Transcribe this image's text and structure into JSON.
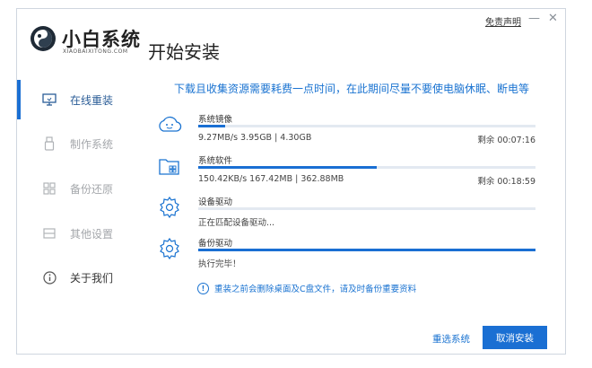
{
  "app": {
    "brand_name": "小白系统",
    "brand_subtitle": "XIAOBAIXITONG.COM",
    "page_title": "开始安装",
    "disclaimer": "免责声明",
    "minimize_glyph": "—",
    "close_glyph": "✕"
  },
  "sidebar": {
    "items": [
      {
        "label": "在线重装",
        "icon": "monitor-icon",
        "active": true
      },
      {
        "label": "制作系统",
        "icon": "usb-drive-icon",
        "active": false
      },
      {
        "label": "备份还原",
        "icon": "grid-icon",
        "active": false
      },
      {
        "label": "其他设置",
        "icon": "settings-box-icon",
        "active": false
      },
      {
        "label": "关于我们",
        "icon": "info-icon",
        "active": false
      }
    ]
  },
  "main": {
    "notice": "下载且收集资源需要耗费一点时间，在此期间尽量不要使电脑休眠、断电等",
    "tasks": [
      {
        "name": "系统镜像",
        "detail": "9.27MB/s 3.95GB | 4.30GB",
        "remaining": "剩余 00:07:16",
        "progress": 0.08,
        "icon": "cloud-download-icon"
      },
      {
        "name": "系统软件",
        "detail": "150.42KB/s 167.42MB | 362.88MB",
        "remaining": "剩余 00:18:59",
        "progress": 0.53,
        "icon": "folder-apps-icon"
      },
      {
        "name": "设备驱动",
        "detail": "正在匹配设备驱动...",
        "remaining": "",
        "progress": 0.0,
        "icon": "gear-icon"
      },
      {
        "name": "备份驱动",
        "detail": "执行完毕！",
        "remaining": "",
        "progress": 1.0,
        "icon": "gear-icon"
      }
    ],
    "warning_text": "重装之前会删除桌面及C盘文件，请及时备份重要资料",
    "warning_glyph": "!"
  },
  "footer": {
    "reselect_label": "重选系统",
    "cancel_label": "取消安装"
  },
  "colors": {
    "accent": "#1a6fd3",
    "track": "#e3e9f1"
  }
}
